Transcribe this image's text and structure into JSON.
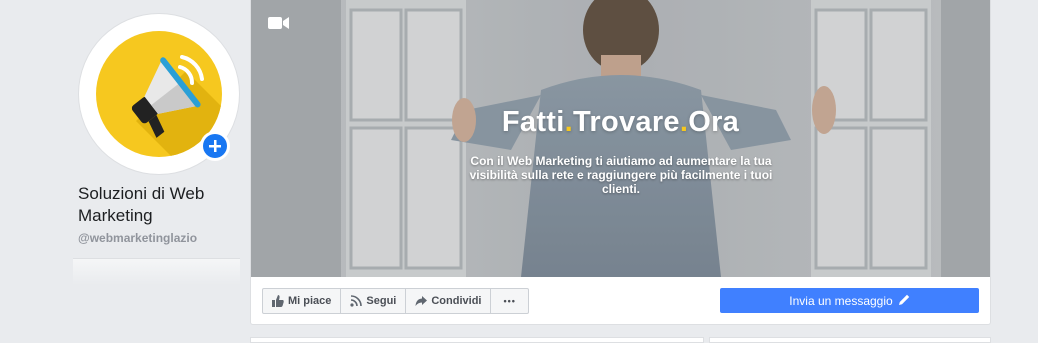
{
  "page": {
    "name": "Soluzioni di Web Marketing",
    "username": "@webmarketinglazio"
  },
  "cover": {
    "title_parts": [
      "Fatti",
      ".",
      "Trovare",
      ".",
      "Ora"
    ],
    "subtitle": "Con il Web Marketing ti aiutiamo ad aumentare la tua visibilità sulla rete e raggiungere più facilmente i tuoi clienti."
  },
  "actions": {
    "like_label": "Mi piace",
    "follow_label": "Segui",
    "share_label": "Condividi",
    "more_label": "•••",
    "message_label": "Invia un messaggio"
  },
  "icons": {
    "avatar": "megaphone-icon",
    "add": "plus-icon",
    "video": "video-camera-icon",
    "like": "thumbs-up-icon",
    "follow": "rss-icon",
    "share": "share-arrow-icon",
    "message": "pencil-icon"
  },
  "colors": {
    "brand_yellow": "#f6c81f",
    "facebook_blue": "#4080ff",
    "add_blue": "#1877f2"
  }
}
